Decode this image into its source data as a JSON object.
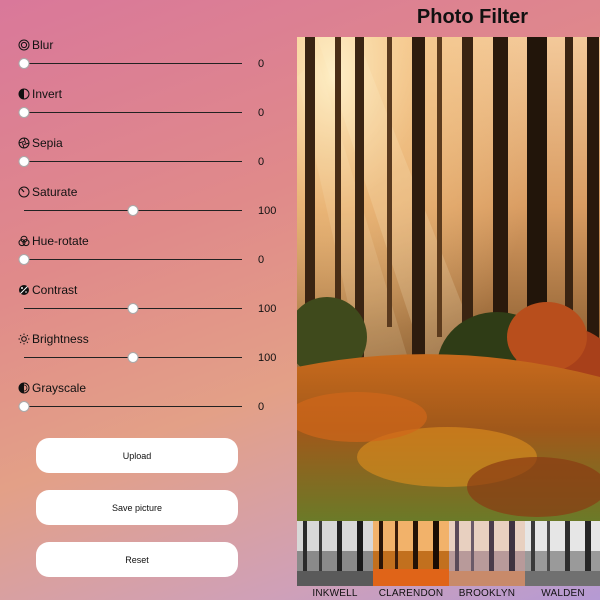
{
  "app": {
    "title": "Photo Filter"
  },
  "controls": [
    {
      "label": "Blur",
      "value": "0",
      "level": 0,
      "icon": "blur-icon"
    },
    {
      "label": "Invert",
      "value": "0",
      "level": 0,
      "icon": "invert-icon"
    },
    {
      "label": "Sepia",
      "value": "0",
      "level": 0,
      "icon": "sepia-icon"
    },
    {
      "label": "Saturate",
      "value": "100",
      "level": 0.5,
      "icon": "saturate-icon"
    },
    {
      "label": "Hue-rotate",
      "value": "0",
      "level": 0,
      "icon": "hue-rotate-icon"
    },
    {
      "label": "Contrast",
      "value": "100",
      "level": 0.5,
      "icon": "contrast-icon"
    },
    {
      "label": "Brightness",
      "value": "100",
      "level": 0.5,
      "icon": "brightness-icon"
    },
    {
      "label": "Grayscale",
      "value": "0",
      "level": 0,
      "icon": "grayscale-icon"
    }
  ],
  "buttons": {
    "upload": "Upload",
    "save": "Save picture",
    "reset": "Reset"
  },
  "presets": [
    {
      "label": "INKWELL"
    },
    {
      "label": "CLARENDON"
    },
    {
      "label": "BROOKLYN"
    },
    {
      "label": "WALDEN"
    }
  ]
}
